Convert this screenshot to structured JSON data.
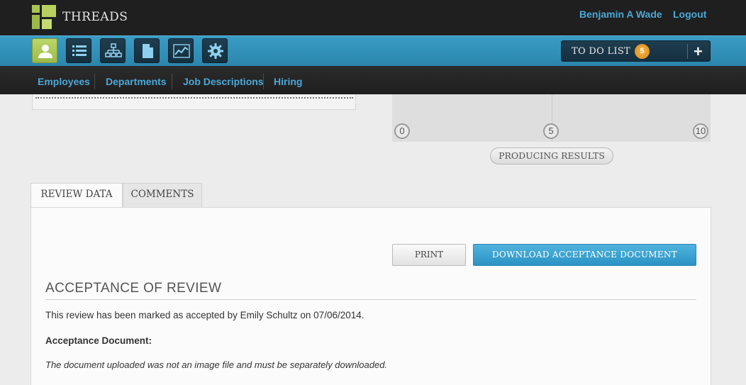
{
  "header": {
    "app_title": "THREADS",
    "user_name": "Benjamin A Wade",
    "logout": "Logout"
  },
  "toolbar": {
    "icons": [
      "user-icon",
      "list-icon",
      "org-chart-icon",
      "document-icon",
      "chart-icon",
      "gear-icon"
    ],
    "active_icon": "user-icon",
    "todo_label": "TO DO LIST",
    "todo_count": "5",
    "todo_add": "+"
  },
  "subnav": {
    "items": [
      "Employees",
      "Departments",
      "Job Descriptions",
      "Hiring"
    ]
  },
  "chart": {
    "ticks": [
      "0",
      "5",
      "10"
    ],
    "label": "PRODUCING RESULTS"
  },
  "tabs": {
    "review_data": "REVIEW DATA",
    "comments": "COMMENTS"
  },
  "content": {
    "print_label": "PRINT",
    "download_label": "DOWNLOAD ACCEPTANCE DOCUMENT",
    "section_title": "ACCEPTANCE OF REVIEW",
    "accepted_text": "This review has been marked as accepted by Emily Schultz on 07/06/2014.",
    "document_label": "Acceptance Document:",
    "document_note": "The document uploaded was not an image file and must be separately downloaded."
  },
  "colors": {
    "accent_blue": "#2b93c4",
    "active_green": "#a9c452",
    "badge_orange": "#e89a2a"
  }
}
